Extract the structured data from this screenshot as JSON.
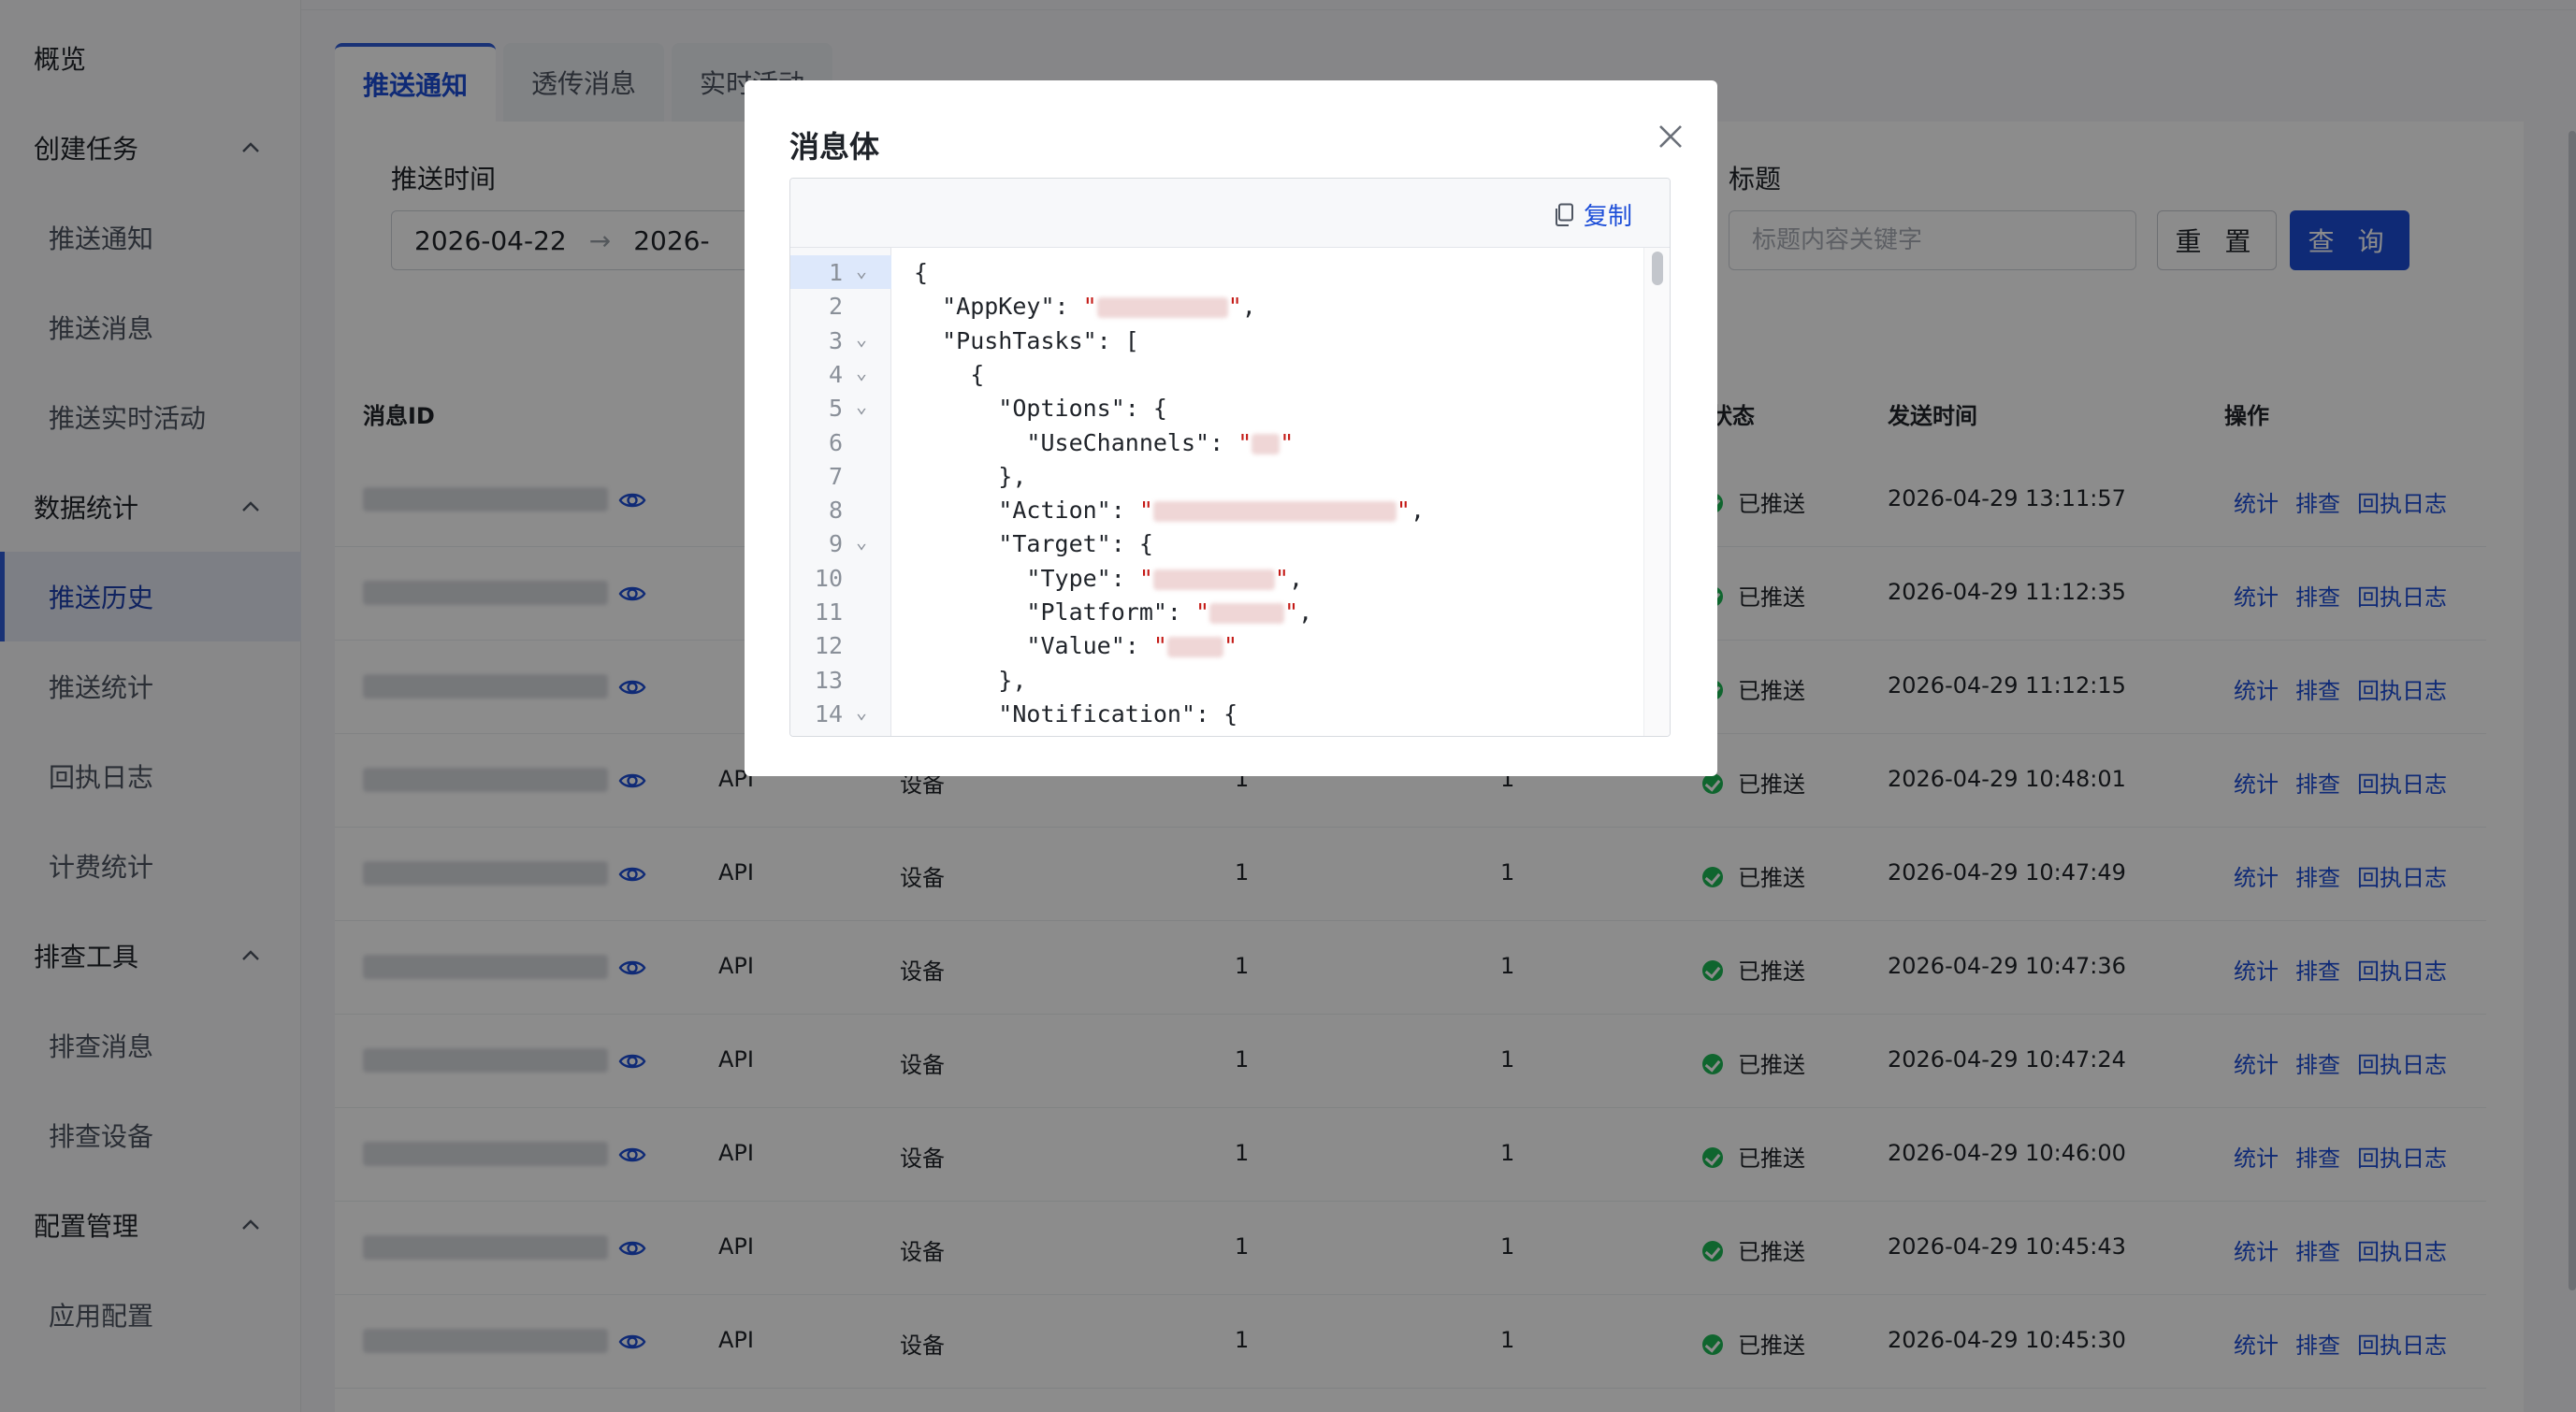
{
  "sidebar": {
    "overview": "概览",
    "groups": [
      {
        "label": "创建任务",
        "items": [
          "推送通知",
          "推送消息",
          "推送实时活动"
        ]
      },
      {
        "label": "数据统计",
        "items": [
          "推送历史",
          "推送统计",
          "回执日志",
          "计费统计"
        ]
      },
      {
        "label": "排查工具",
        "items": [
          "排查消息",
          "排查设备"
        ]
      },
      {
        "label": "配置管理",
        "items": [
          "应用配置"
        ]
      }
    ],
    "active_item": "推送历史"
  },
  "tabs": [
    "推送通知",
    "透传消息",
    "实时活动"
  ],
  "filters": {
    "time_label": "推送时间",
    "start_date": "2026-04-22",
    "end_date": "2026-",
    "date_separator": "→",
    "title_label": "标题",
    "title_placeholder": "标题内容关键字",
    "reset_label": "重 置",
    "query_label": "查 询"
  },
  "table": {
    "headers": {
      "msg_id": "消息ID",
      "status": "状态",
      "send_time": "发送时间",
      "actions": "操作"
    },
    "status_text": "已推送",
    "action_labels": [
      "统计",
      "排查",
      "回执日志"
    ],
    "rows": [
      {
        "source": "",
        "target": "",
        "c1": "",
        "c2": "",
        "time": "2026-04-29 13:11:57"
      },
      {
        "source": "",
        "target": "",
        "c1": "",
        "c2": "",
        "time": "2026-04-29 11:12:35"
      },
      {
        "source": "",
        "target": "",
        "c1": "",
        "c2": "",
        "time": "2026-04-29 11:12:15"
      },
      {
        "source": "API",
        "target": "设备",
        "c1": "1",
        "c2": "1",
        "time": "2026-04-29 10:48:01"
      },
      {
        "source": "API",
        "target": "设备",
        "c1": "1",
        "c2": "1",
        "time": "2026-04-29 10:47:49"
      },
      {
        "source": "API",
        "target": "设备",
        "c1": "1",
        "c2": "1",
        "time": "2026-04-29 10:47:36"
      },
      {
        "source": "API",
        "target": "设备",
        "c1": "1",
        "c2": "1",
        "time": "2026-04-29 10:47:24"
      },
      {
        "source": "API",
        "target": "设备",
        "c1": "1",
        "c2": "1",
        "time": "2026-04-29 10:46:00"
      },
      {
        "source": "API",
        "target": "设备",
        "c1": "1",
        "c2": "1",
        "time": "2026-04-29 10:45:43"
      },
      {
        "source": "API",
        "target": "设备",
        "c1": "1",
        "c2": "1",
        "time": "2026-04-29 10:45:30"
      }
    ]
  },
  "modal": {
    "title": "消息体",
    "copy_label": "复制",
    "active_line": 1,
    "lines": [
      {
        "n": "1",
        "fold": true,
        "pre": "{",
        "post": ""
      },
      {
        "n": "2",
        "fold": false,
        "pre": "  \"AppKey\": ",
        "post": ","
      },
      {
        "n": "3",
        "fold": true,
        "pre": "  \"PushTasks\": [",
        "post": ""
      },
      {
        "n": "4",
        "fold": true,
        "pre": "    {",
        "post": ""
      },
      {
        "n": "5",
        "fold": true,
        "pre": "      \"Options\": {",
        "post": ""
      },
      {
        "n": "6",
        "fold": false,
        "pre": "        \"UseChannels\": ",
        "post": ""
      },
      {
        "n": "7",
        "fold": false,
        "pre": "      },",
        "post": ""
      },
      {
        "n": "8",
        "fold": false,
        "pre": "      \"Action\": ",
        "post": ","
      },
      {
        "n": "9",
        "fold": true,
        "pre": "      \"Target\": {",
        "post": ""
      },
      {
        "n": "10",
        "fold": false,
        "pre": "        \"Type\": ",
        "post": ","
      },
      {
        "n": "11",
        "fold": false,
        "pre": "        \"Platform\": ",
        "post": ","
      },
      {
        "n": "12",
        "fold": false,
        "pre": "        \"Value\": ",
        "post": ""
      },
      {
        "n": "13",
        "fold": false,
        "pre": "      },",
        "post": ""
      },
      {
        "n": "14",
        "fold": true,
        "pre": "      \"Notification\": {",
        "post": ""
      }
    ]
  },
  "colors": {
    "accent": "#1d4ed8",
    "success": "#1db954",
    "string": "#c41a16"
  }
}
